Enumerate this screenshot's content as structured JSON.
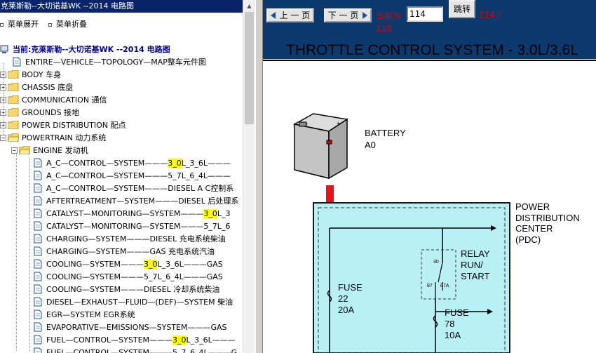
{
  "tree_title": "克莱斯勒--大切诺基WK --2014 电路图",
  "menu_expand": "菜单展开",
  "menu_collapse": "菜单折叠",
  "current": "当前:克莱斯勒--大切诺基WK --2014 电路图",
  "items": [
    {
      "label": "ENTIRE—VEHICLE—TOPOLOGY—MAP整车元件图"
    },
    {
      "label": "BODY 车身"
    },
    {
      "label": "CHASSIS 底盘"
    },
    {
      "label": "COMMUNICATION 通信"
    },
    {
      "label": "GROUNDS 接地"
    },
    {
      "label": "POWER DISTRIBUTION 配点"
    },
    {
      "label": "POWERTRAIN 动力系统"
    },
    {
      "label": "ENGINE 发动机"
    }
  ],
  "engine_items": [
    {
      "pre": "A_C—CONTROL—SYSTEM———",
      "hl": "3_0",
      "post": "L_3_6L———"
    },
    {
      "pre": "A_C—CONTROL—SYSTEM———5_7L_6_4L———",
      "hl": "",
      "post": ""
    },
    {
      "pre": "A_C—CONTROL—SYSTEM———DIESEL A C控制系",
      "hl": "",
      "post": ""
    },
    {
      "pre": "AFTERTREATMENT—SYSTEM———DIESEL 后处理系",
      "hl": "",
      "post": ""
    },
    {
      "pre": "CATALYST—MONITORING—SYSTEM———",
      "hl": "3_0",
      "post": "L_3"
    },
    {
      "pre": "CATALYST—MONITORING—SYSTEM———5_7L_6",
      "hl": "",
      "post": ""
    },
    {
      "pre": "CHARGING—SYSTEM———DIESEL 充电系统柴油",
      "hl": "",
      "post": ""
    },
    {
      "pre": "CHARGING—SYSTEM———GAS 充电系统汽油",
      "hl": "",
      "post": ""
    },
    {
      "pre": "COOLING—SYSTEM———",
      "hl": "3_0",
      "post": "L_3_6L———GAS"
    },
    {
      "pre": "COOLING—SYSTEM———5_7L_6_4L———GAS",
      "hl": "",
      "post": ""
    },
    {
      "pre": "COOLING—SYSTEM———DIESEL 冷却系统柴油",
      "hl": "",
      "post": ""
    },
    {
      "pre": "DIESEL—EXHAUST—FLUID—(DEF)—SYSTEM 柴油",
      "hl": "",
      "post": ""
    },
    {
      "pre": "EGR—SYSTEM EGR系统",
      "hl": "",
      "post": ""
    },
    {
      "pre": "EVAPORATIVE—EMISSIONS—SYSTEM———GAS",
      "hl": "",
      "post": ""
    },
    {
      "pre": "FUEL—CONTROL—SYSTEM———",
      "hl": "3_0",
      "post": "L_3_6L———"
    },
    {
      "pre": "FUEL—CONTROL—SYSTEM———5_7_6_4L———G",
      "hl": "",
      "post": ""
    }
  ],
  "nav": {
    "prev_label": "上 一 页",
    "next_label": "下 一 页",
    "current_label": "当前为",
    "page_value": "114",
    "go_label": "跳转",
    "total_a": "114 /",
    "total_b": "118"
  },
  "diagram": {
    "title": "THROTTLE CONTROL SYSTEM - 3.0L/3.6L",
    "battery_label": "BATTERY",
    "battery_code": "A0",
    "pdc_label_1": "POWER",
    "pdc_label_2": "DISTRIBUTION",
    "pdc_label_3": "CENTER",
    "pdc_label_4": "(PDC)",
    "relay_1": "RELAY",
    "relay_2": "RUN/",
    "relay_3": "START",
    "pin30": "30",
    "pin87": "87",
    "pin87a": "87A",
    "fuse1_label": "FUSE",
    "fuse1_num": "22",
    "fuse1_amp": "20A",
    "fuse2_label": "FUSE",
    "fuse2_num": "78",
    "fuse2_amp": "10A"
  }
}
